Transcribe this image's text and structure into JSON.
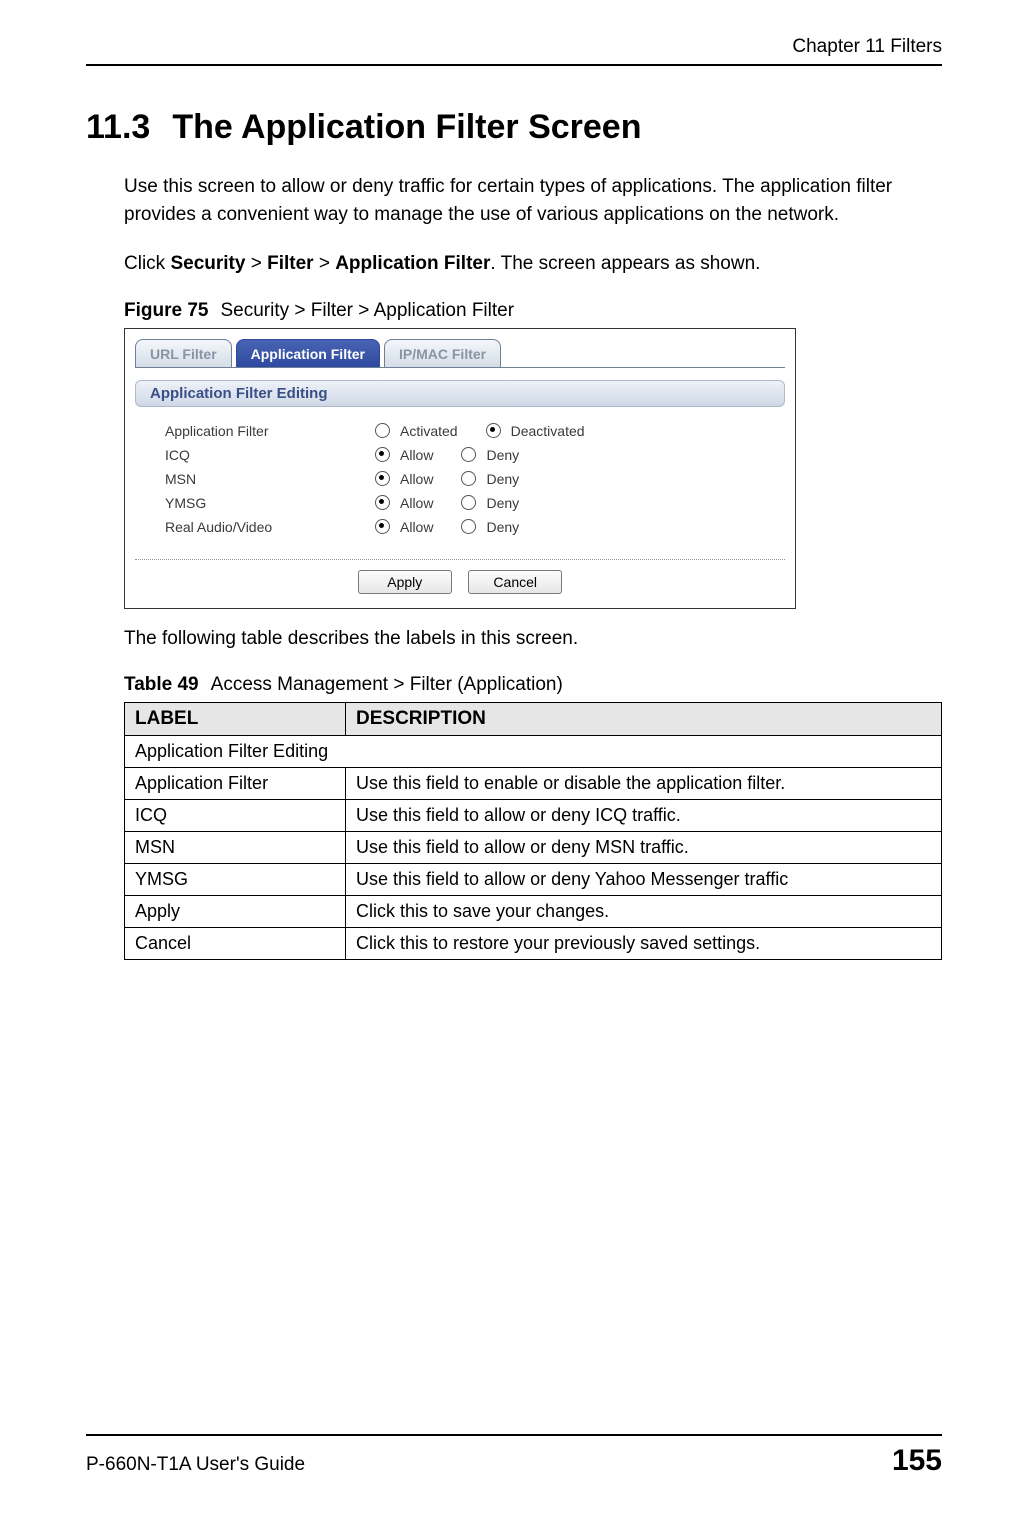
{
  "header": {
    "chapter_label": "Chapter 11 Filters"
  },
  "section": {
    "number": "11.3",
    "title": "The Application Filter Screen"
  },
  "paragraphs": {
    "intro": "Use this screen to allow or deny traffic for certain types of applications. The application filter provides a convenient way to manage the use of various applications on the network.",
    "click_prefix": "Click ",
    "click_path1": "Security",
    "click_sep1": " > ",
    "click_path2": "Filter",
    "click_sep2": " > ",
    "click_path3": "Application Filter",
    "click_suffix": ". The screen appears as shown.",
    "after_fig": "The following table describes the labels in this screen."
  },
  "figure": {
    "num": "Figure 75",
    "caption": "Security > Filter > Application Filter"
  },
  "screenshot": {
    "tabs": {
      "url_filter": "URL Filter",
      "app_filter": "Application Filter",
      "ipmac_filter": "IP/MAC Filter"
    },
    "section_title": "Application Filter Editing",
    "rows": [
      {
        "label": "Application Filter",
        "opt1": "Activated",
        "opt2": "Deactivated",
        "checked_index": 1
      },
      {
        "label": "ICQ",
        "opt1": "Allow",
        "opt2": "Deny",
        "checked_index": 0
      },
      {
        "label": "MSN",
        "opt1": "Allow",
        "opt2": "Deny",
        "checked_index": 0
      },
      {
        "label": "YMSG",
        "opt1": "Allow",
        "opt2": "Deny",
        "checked_index": 0
      },
      {
        "label": "Real Audio/Video",
        "opt1": "Allow",
        "opt2": "Deny",
        "checked_index": 0
      }
    ],
    "buttons": {
      "apply": "Apply",
      "cancel": "Cancel"
    }
  },
  "table": {
    "num": "Table 49",
    "caption": "Access Management > Filter (Application)",
    "head_label": "LABEL",
    "head_desc": "DESCRIPTION",
    "rows": [
      {
        "label": "Application Filter Editing",
        "desc": "",
        "colspan": true
      },
      {
        "label": "Application Filter",
        "desc": "Use this field to enable or disable the application filter."
      },
      {
        "label": "ICQ",
        "desc": "Use this field to allow or deny ICQ traffic."
      },
      {
        "label": "MSN",
        "desc": "Use this field to allow or deny MSN traffic."
      },
      {
        "label": "YMSG",
        "desc": "Use this field to allow or deny Yahoo Messenger traffic"
      },
      {
        "label": "Apply",
        "desc": "Click this to save your changes."
      },
      {
        "label": "Cancel",
        "desc": "Click this to restore your previously saved settings."
      }
    ]
  },
  "footer": {
    "guide": "P-660N-T1A User's Guide",
    "page": "155"
  }
}
